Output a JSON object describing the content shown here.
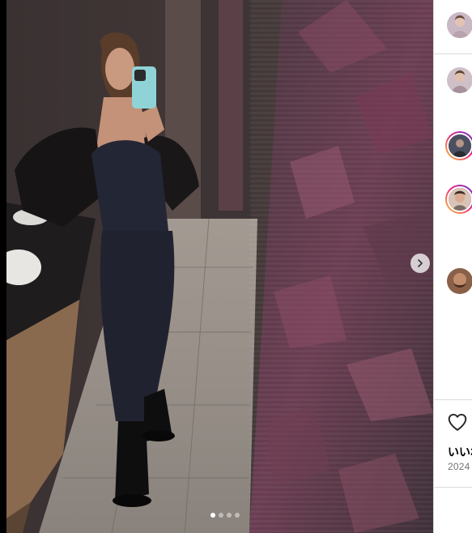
{
  "post": {
    "image_alt": "",
    "carousel": {
      "count": 4,
      "active_index": 0
    }
  },
  "sidebar": {
    "comments": [
      {
        "avatar": "avatar-1",
        "has_story_ring": false
      },
      {
        "avatar": "avatar-2",
        "has_story_ring": false
      },
      {
        "avatar": "avatar-3",
        "has_story_ring": true
      },
      {
        "avatar": "avatar-4",
        "has_story_ring": true
      },
      {
        "avatar": "avatar-5",
        "has_story_ring": false
      }
    ],
    "likes_label": "いいね",
    "date_label": "2024"
  },
  "icons": {
    "next": "chevron-right-icon",
    "like": "heart-icon"
  },
  "colors": {
    "ring_start": "#f9ce34",
    "ring_mid": "#ee2a7b",
    "ring_end": "#6228d7",
    "secondary_text": "#737373",
    "border": "#dbdbdb"
  }
}
